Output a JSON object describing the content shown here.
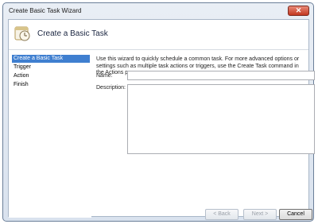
{
  "window": {
    "title": "Create Basic Task Wizard",
    "close_glyph": "✕"
  },
  "header": {
    "title": "Create a Basic Task",
    "icon": "task-scheduler-icon"
  },
  "sidebar": {
    "items": [
      {
        "label": "Create a Basic Task",
        "selected": true
      },
      {
        "label": "Trigger"
      },
      {
        "label": "Action"
      },
      {
        "label": "Finish"
      }
    ]
  },
  "main": {
    "description": "Use this wizard to quickly schedule a common task.  For more advanced options or settings such as multiple task actions or triggers, use the Create Task command in the Actions pane.",
    "name_label": "Name:",
    "name_value": "",
    "description_label": "Description:",
    "description_value": ""
  },
  "buttons": {
    "back": "< Back",
    "next": "Next >",
    "cancel": "Cancel"
  },
  "colors": {
    "selection": "#3f7fd0",
    "close": "#c2371f"
  }
}
